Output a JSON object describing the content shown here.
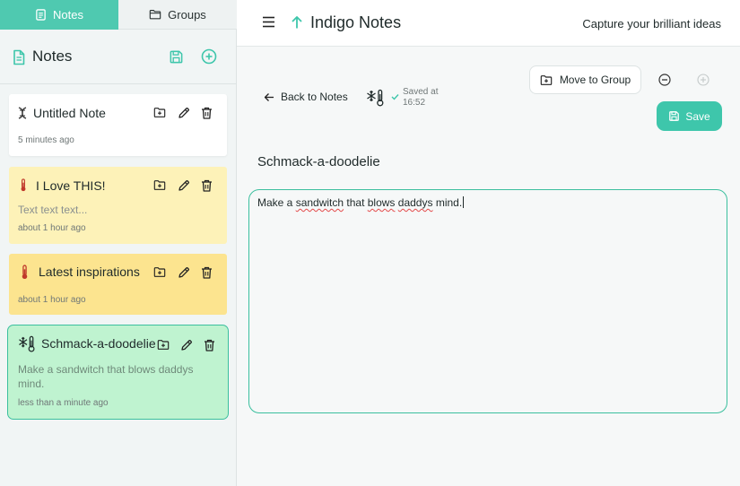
{
  "sidebar": {
    "tabs": [
      {
        "label": "Notes",
        "icon": "note-icon",
        "active": true
      },
      {
        "label": "Groups",
        "icon": "folder-icon",
        "active": false
      }
    ],
    "header": {
      "title": "Notes",
      "icon": "document-icon"
    },
    "notes": [
      {
        "title": "Untitled Note",
        "icon": "dna-icon",
        "preview": "",
        "time": "5 minutes ago",
        "color": "#ffffff"
      },
      {
        "title": "I Love THIS!",
        "icon": "thermometer-icon",
        "preview": "Text text text...",
        "time": "about 1 hour ago",
        "color": "#fdf2b8"
      },
      {
        "title": "Latest inspirations",
        "icon": "thermometer-icon",
        "preview": "",
        "time": "about 1 hour ago",
        "color": "#fce48f"
      },
      {
        "title": "Schmack-a-doodelie",
        "icon": "snowflake-thermometer-icon",
        "preview_line1": "Make a sandwitch that blows daddys",
        "preview_line2": "mind.",
        "time": "less than a minute ago",
        "color": "#bff3d0",
        "selected": true
      }
    ]
  },
  "topbar": {
    "app_title": "Indigo Notes",
    "tagline": "Capture your brilliant ideas"
  },
  "editor": {
    "back_label": "Back to Notes",
    "saved_line1": "Saved at",
    "saved_line2": "16:52",
    "move_label": "Move to Group",
    "save_label": "Save",
    "note_title": "Schmack-a-doodelie",
    "body": {
      "w1": "Make a ",
      "w2": "sandwitch",
      "w3": " that ",
      "w4": "blows",
      "w5": " ",
      "w6": "daddys",
      "w7": " mind."
    }
  },
  "colors": {
    "accent": "#3ec6ab",
    "tab_active": "#4fc9b0",
    "selected_border": "#3bbf9e"
  }
}
